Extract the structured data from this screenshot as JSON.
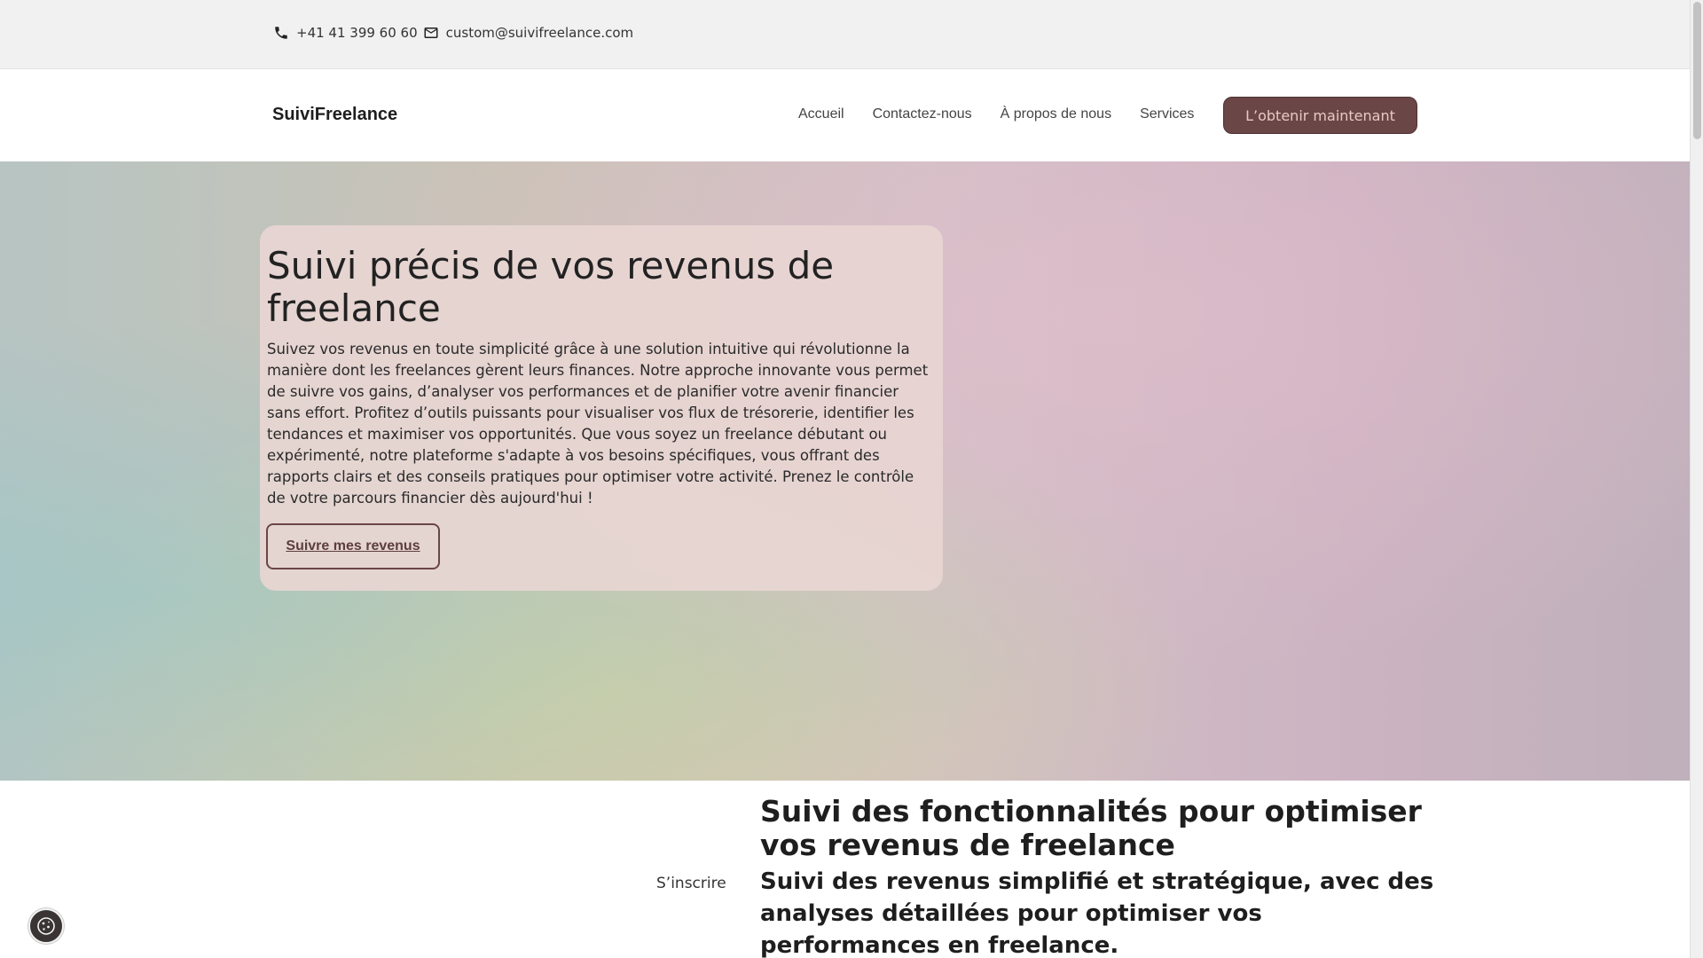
{
  "topbar": {
    "phone": "+41 41 399 60 60",
    "email": "custom@suivifreelance.com"
  },
  "header": {
    "brand": "SuiviFreelance",
    "nav": [
      "Accueil",
      "Contactez-nous",
      "À propos de nous",
      "Services"
    ],
    "cta_label": "L’obtenir maintenant"
  },
  "hero": {
    "title": "Suivi précis de vos revenus de freelance",
    "text": "Suivez vos revenus en toute simplicité grâce à une solution intuitive qui révolutionne la manière dont les freelances gèrent leurs finances. Notre approche innovante vous permet de suivre vos gains, d’analyser vos performances et de planifier votre avenir financier sans effort. Profitez d’outils puissants pour visualiser vos flux de trésorerie, identifier les tendances et maximiser vos opportunités. Que vous soyez un freelance débutant ou expérimenté, notre plateforme s'adapte à vos besoins spécifiques, vous offrant des rapports clairs et des conseils pratiques pour optimiser votre activité. Prenez le contrôle de votre parcours financier dès aujourd'hui !",
    "button_label": "Suivre mes revenus"
  },
  "features": {
    "signup_label": "S’inscrire",
    "title": "Suivi des fonctionnalités pour optimiser vos revenus de freelance",
    "subtitle": "Suivi des revenus simplifié et stratégique, avec des analyses détaillées pour optimiser vos performances en freelance."
  },
  "icons": {
    "phone": "phone-icon",
    "email": "envelope-icon",
    "cookie": "cookie-icon"
  },
  "colors": {
    "accent": "#6b4646",
    "cta_text": "#e6c9c4",
    "card_bg": "#e8d6d3"
  }
}
